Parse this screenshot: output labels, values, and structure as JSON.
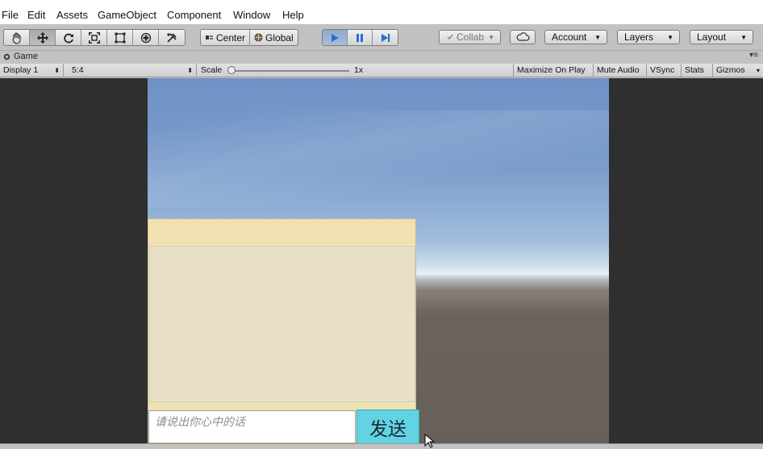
{
  "menu": {
    "items": [
      "File",
      "Edit",
      "Assets",
      "GameObject",
      "Component",
      "Window",
      "Help"
    ]
  },
  "toolbar": {
    "transform_tools": [
      "hand-tool-icon",
      "move-tool-icon",
      "rotate-tool-icon",
      "scale-tool-icon",
      "rect-tool-icon",
      "transform-tool-icon",
      "custom-tool-icon"
    ],
    "pivot_label": "Center",
    "space_label": "Global",
    "collab_label": "Collab",
    "account_label": "Account",
    "layers_label": "Layers",
    "layout_label": "Layout"
  },
  "game_tab": {
    "label": "Game"
  },
  "game_toolbar": {
    "display": "Display 1",
    "aspect": "5:4",
    "scale_label": "Scale",
    "scale_value": "1x",
    "maximize_on_play": "Maximize On Play",
    "mute_audio": "Mute Audio",
    "vsync": "VSync",
    "stats": "Stats",
    "gizmos": "Gizmos"
  },
  "chat": {
    "input_placeholder": "请说出你心中的话",
    "send_label": "发送"
  },
  "colors": {
    "sky_top": "#6e92c6",
    "ground": "#67605a",
    "chat_panel": "#f0e3b2",
    "send_button": "#62d3e3",
    "play_active": "#8fa9c9"
  }
}
